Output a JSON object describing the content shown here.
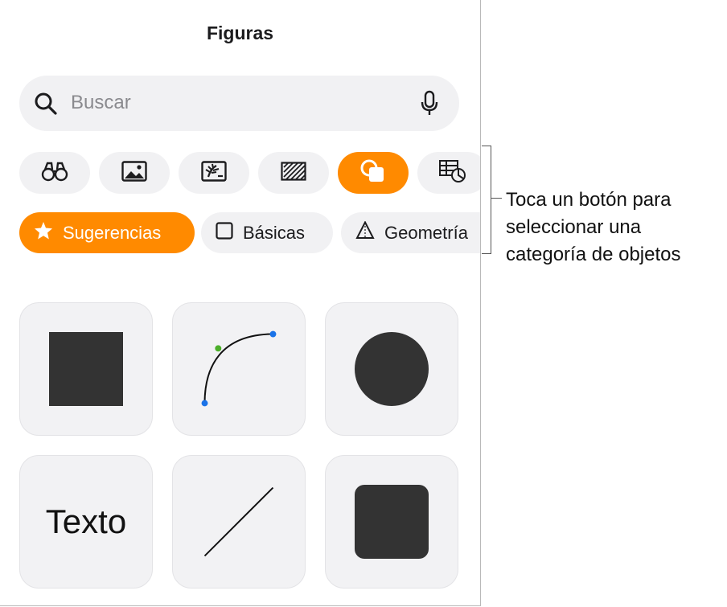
{
  "panel": {
    "title": "Figuras",
    "search": {
      "placeholder": "Buscar"
    },
    "categories": [
      {
        "icon": "binoculars-icon",
        "active": false
      },
      {
        "icon": "image-icon",
        "active": false
      },
      {
        "icon": "media-icon",
        "active": false
      },
      {
        "icon": "pattern-icon",
        "active": false
      },
      {
        "icon": "shapes-icon",
        "active": true
      },
      {
        "icon": "table-chart-icon",
        "active": false
      }
    ],
    "chips": [
      {
        "label": "Sugerencias",
        "icon": "star-icon",
        "active": true
      },
      {
        "label": "Básicas",
        "icon": "square-outline-icon",
        "active": false
      },
      {
        "label": "Geometría",
        "icon": "pyramid-icon",
        "active": false
      }
    ],
    "shapes": [
      {
        "name": "square"
      },
      {
        "name": "curve"
      },
      {
        "name": "circle"
      },
      {
        "name": "text",
        "label": "Texto"
      },
      {
        "name": "line"
      },
      {
        "name": "rounded-square"
      }
    ]
  },
  "callout": {
    "lines": [
      "Toca un botón para",
      "seleccionar una",
      "categoría de objetos"
    ]
  },
  "colors": {
    "accent": "#ff8a00",
    "shape_fill": "#333333",
    "tile_bg": "#f2f2f4",
    "control_bg": "#f1f1f3"
  }
}
